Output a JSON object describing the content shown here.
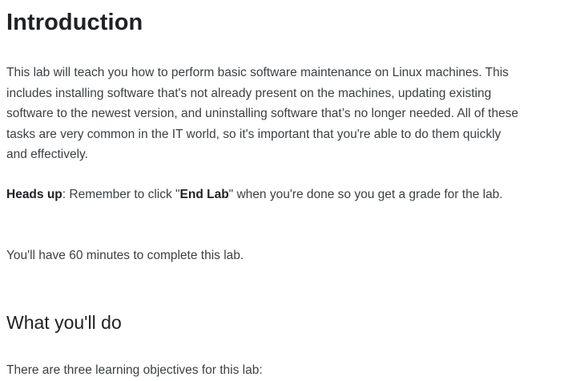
{
  "intro": {
    "title": "Introduction",
    "paragraph": "This lab will teach you how to perform basic software maintenance on Linux machines. This includes installing software that's not already present on the machines, updating existing software to the newest version, and uninstalling software that’s no longer needed. All of these tasks are very common in the IT world, so it's important that you're able to do them quickly and effectively."
  },
  "heads_up": {
    "label": "Heads up",
    "text_before": ": Remember to click \"",
    "bold_action": "End Lab",
    "text_after": "\" when you're done so you get a grade for the lab."
  },
  "time_note": "You'll have 60 minutes to complete this lab.",
  "what_youll_do": {
    "title": "What you'll do",
    "paragraph": "There are three learning objectives for this lab:"
  }
}
